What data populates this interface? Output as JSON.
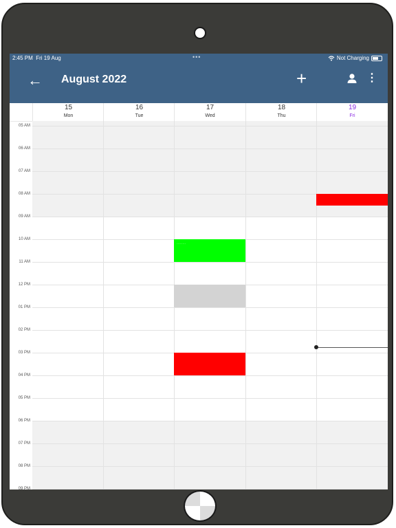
{
  "status_bar": {
    "time": "2:45 PM",
    "date": "Fri 19 Aug",
    "charging": "Not Charging",
    "multitask_icon": "ellipsis",
    "wifi_icon": "wifi-icon",
    "battery_icon": "battery-icon"
  },
  "app_bar": {
    "back_icon": "arrow-left-icon",
    "title": "August 2022",
    "add_icon": "plus-icon",
    "account_icon": "person-icon",
    "menu_icon": "more-vertical-icon"
  },
  "week": {
    "days": [
      {
        "num": "15",
        "name": "Mon",
        "today": false
      },
      {
        "num": "16",
        "name": "Tue",
        "today": false
      },
      {
        "num": "17",
        "name": "Wed",
        "today": false
      },
      {
        "num": "18",
        "name": "Thu",
        "today": false
      },
      {
        "num": "19",
        "name": "Fri",
        "today": true
      }
    ],
    "today_color": "#8a2be2"
  },
  "hours": [
    "05 AM",
    "06 AM",
    "07 AM",
    "08 AM",
    "09 AM",
    "10 AM",
    "11 AM",
    "12 PM",
    "01 PM",
    "02 PM",
    "03 PM",
    "04 PM",
    "05 PM",
    "06 PM",
    "07 PM",
    "08 PM",
    "09 PM"
  ],
  "working_hours": {
    "start": "09 AM",
    "end": "06 PM"
  },
  "current_time_indicator": {
    "day": "Fri",
    "time": "02:45 PM"
  },
  "events": [
    {
      "day": "Fri",
      "start": "08 AM",
      "end": "08:30 AM",
      "color": "#ff0000",
      "label": ""
    },
    {
      "day": "Wed",
      "start": "10 AM",
      "end": "11 AM",
      "color": "#00ff00",
      "label": "........"
    },
    {
      "day": "Wed",
      "start": "12 PM",
      "end": "01 PM",
      "color": "#d3d3d3",
      "label": ""
    },
    {
      "day": "Wed",
      "start": "03 PM",
      "end": "04 PM",
      "color": "#ff0000",
      "label": ""
    }
  ],
  "colors": {
    "app_bar": "#3e6286",
    "off_hours": "#f1f1f1",
    "device_frame": "#3b3b38"
  }
}
